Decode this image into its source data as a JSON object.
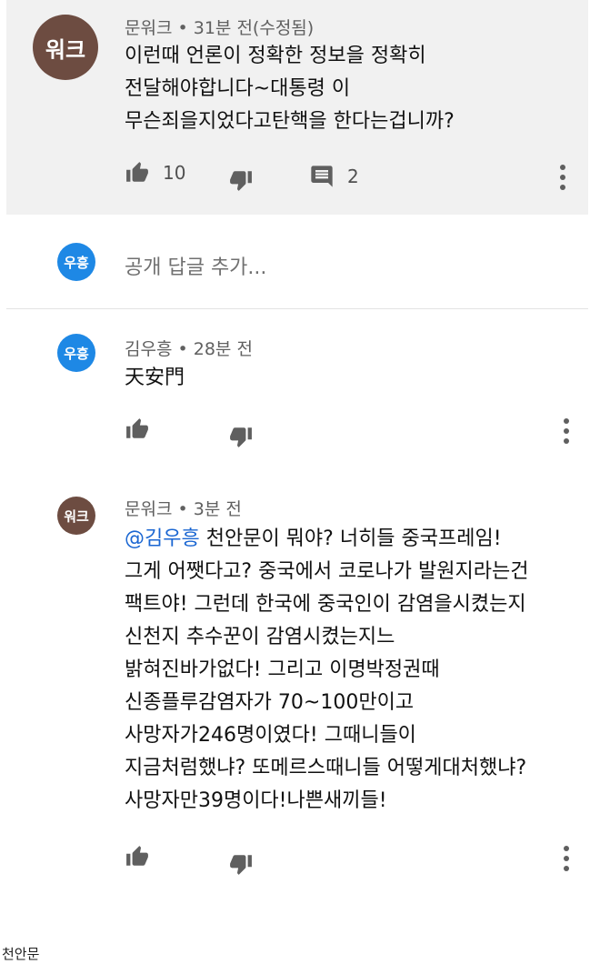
{
  "top_comment": {
    "avatar_text": "워크",
    "author": "문워크",
    "time": "31분 전(수정됨)",
    "lines": [
      "이런때  언론이 정확한 정보을  정확히",
      "전달해야합니다~대통령 이",
      "무슨죄을지었다고탄핵을 한다는겁니까?"
    ],
    "like_count": "10",
    "reply_count": "2"
  },
  "reply_box": {
    "avatar_text": "우흥",
    "placeholder": "공개 답글 추가..."
  },
  "replies": [
    {
      "avatar_text": "우흥",
      "author": "김우흥",
      "time": "28분 전",
      "lines": [
        "天安門"
      ]
    },
    {
      "avatar_text": "워크",
      "author": "문워크",
      "time": "3분 전",
      "mention": "@김우흥",
      "first_line_rest": " 천안문이 뭐야? 너히들 중국프레임!",
      "lines": [
        "그게 어쨋다고? 중국에서 코로나가 발원지라는건",
        "팩트야! 그런데 한국에 중국인이  감염을시켰는지",
        "신천지 추수꾼이 감염시켰는지느",
        "밝혀진바가없다! 그리고 이명박정권때",
        "신종플루감염자가 70~100만이고",
        "사망자가246명이였다! 그때니들이",
        "지금처럼했냐? 또메르스때니들 어떻게대처했냐?",
        "사망자만39명이다!나쁜새끼들!"
      ]
    }
  ],
  "caption": "천안문",
  "colors": {
    "top_comment_bg": "#f1f1f1",
    "brown_avatar": "#6d4c41",
    "blue_avatar": "#1e88e5",
    "mention": "#1a66d2"
  },
  "icons": [
    "thumb-up-icon",
    "thumb-down-icon",
    "comment-icon",
    "more-vert-icon"
  ]
}
